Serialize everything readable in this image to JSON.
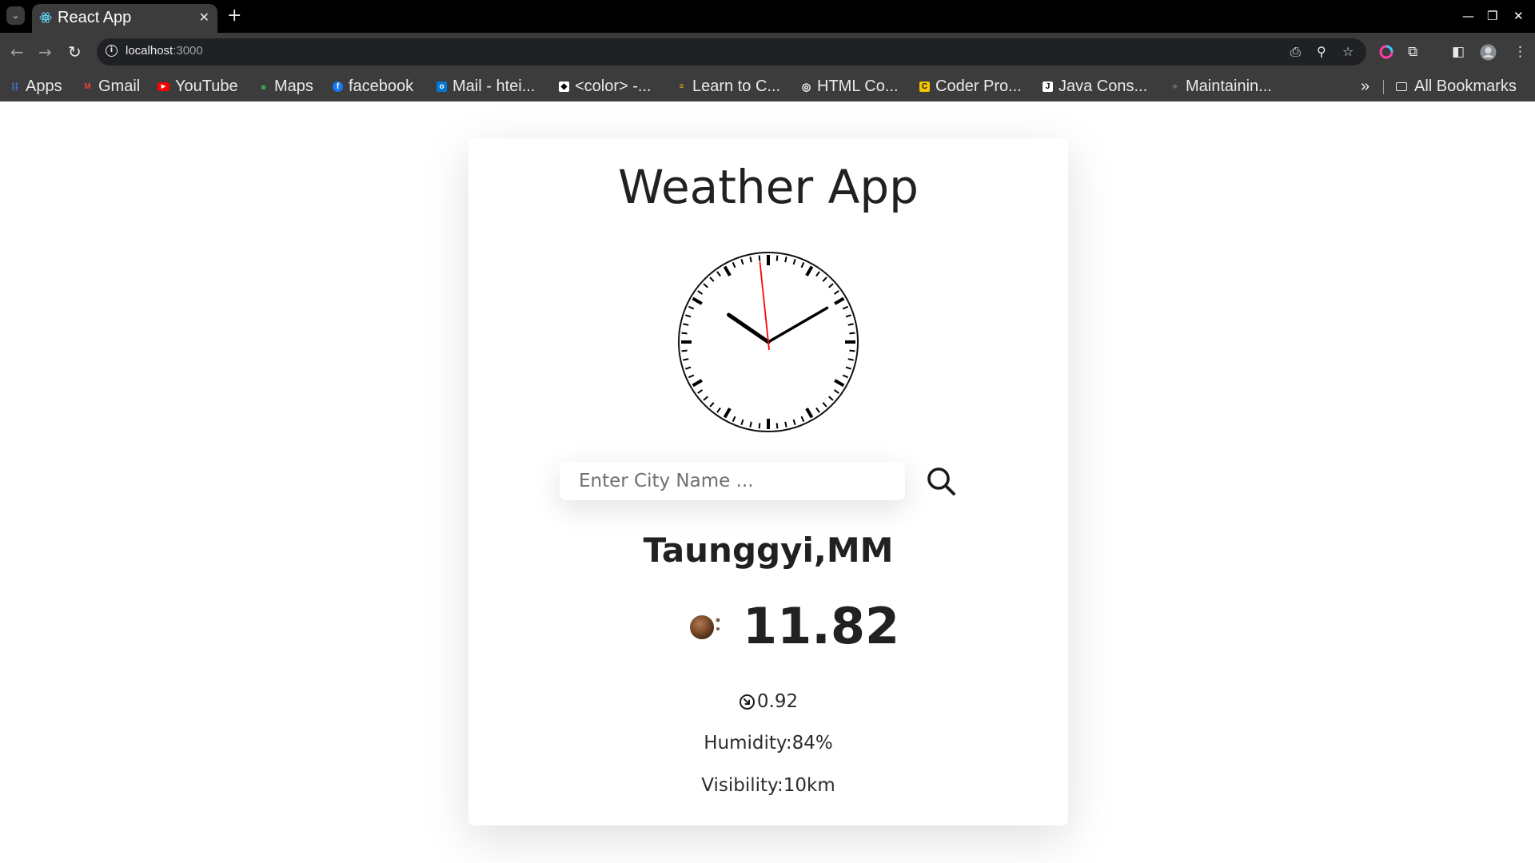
{
  "browser": {
    "tab": {
      "title": "React App",
      "close_glyph": "✕",
      "favicon": "react-icon"
    },
    "new_tab_glyph": "+",
    "url": {
      "host": "localhost",
      "port": ":3000"
    },
    "bookmarks": [
      {
        "label": "Apps",
        "icon": "apps-grid-icon",
        "color": "#4285f4"
      },
      {
        "label": "Gmail",
        "icon": "gmail-icon",
        "color": "#ea4335"
      },
      {
        "label": "YouTube",
        "icon": "youtube-icon",
        "color": "#ff0000"
      },
      {
        "label": "Maps",
        "icon": "maps-pin-icon",
        "color": "#34a853"
      },
      {
        "label": "facebook",
        "icon": "facebook-icon",
        "color": "#1877f2"
      },
      {
        "label": "Mail - htei...",
        "icon": "outlook-icon",
        "color": "#0078d4"
      },
      {
        "label": "<color> -...",
        "icon": "mdn-icon",
        "color": "#000000"
      },
      {
        "label": "Learn to C...",
        "icon": "learn-icon",
        "color": "#f6a623"
      },
      {
        "label": "HTML Co...",
        "icon": "globe-icon",
        "color": "#ffffff"
      },
      {
        "label": "Coder Pro...",
        "icon": "coder-icon",
        "color": "#f5c400"
      },
      {
        "label": "Java Cons...",
        "icon": "java-icon",
        "color": "#000000"
      },
      {
        "label": "Maintainin...",
        "icon": "maintain-icon",
        "color": "#7a7a7a"
      }
    ],
    "more_bookmarks_glyph": "»",
    "all_bookmarks": "All Bookmarks"
  },
  "app": {
    "title": "Weather App",
    "clock": {
      "hour": 10,
      "minute": 9,
      "second": 59
    },
    "search": {
      "placeholder": "Enter City Name ...",
      "value": ""
    },
    "city": "Taunggyi,MM",
    "temperature": "11.82",
    "weather_icon": "weather-condition-icon",
    "wind": "0.92",
    "humidity": "Humidity:84%",
    "visibility": "Visibility:10km"
  }
}
